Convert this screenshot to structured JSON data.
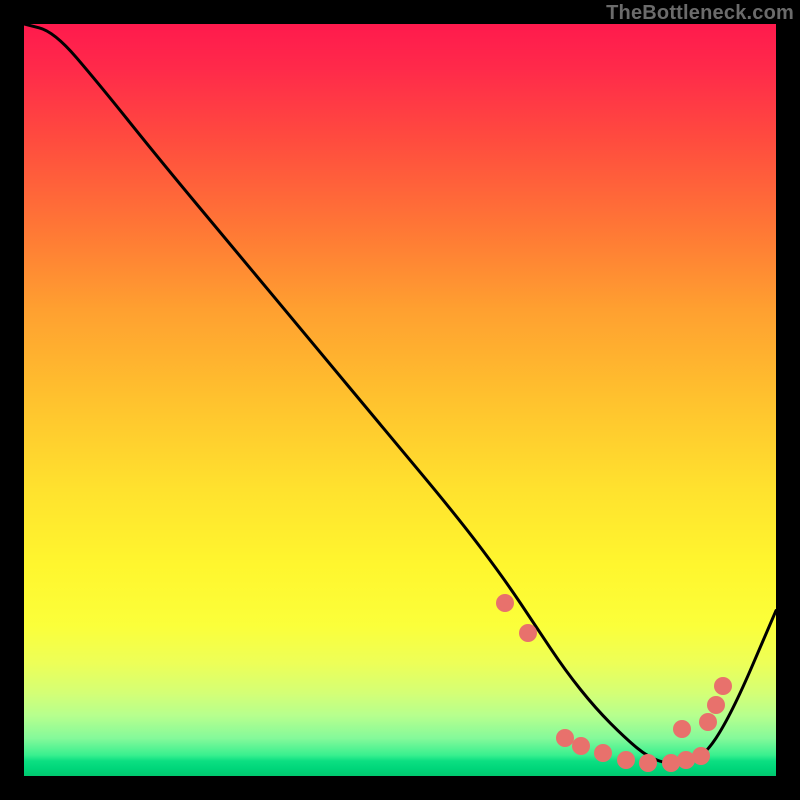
{
  "attribution": "TheBottleneck.com",
  "colors": {
    "line": "#000000",
    "dots": "#e8716c",
    "background": "#000000"
  },
  "chart_data": {
    "type": "line",
    "title": "",
    "xlabel": "",
    "ylabel": "",
    "xlim": [
      0,
      100
    ],
    "ylim": [
      0,
      100
    ],
    "grid": false,
    "note": "axes hidden; y inverted visually (curve minimum at bottom)",
    "series": [
      {
        "name": "bottleneck-curve",
        "x": [
          0,
          4,
          10,
          18,
          28,
          38,
          48,
          58,
          64,
          68,
          72,
          76,
          80,
          83,
          86,
          90,
          94,
          100
        ],
        "y": [
          100,
          99,
          92,
          82,
          70,
          58,
          46,
          34,
          26,
          20,
          14,
          9,
          5,
          2.5,
          1.5,
          2,
          8,
          22
        ]
      }
    ],
    "dots": {
      "name": "dot-cluster",
      "series_ref": "bottleneck-curve",
      "x": [
        64,
        67,
        72,
        74,
        77,
        80,
        83,
        86,
        88,
        87.5,
        90,
        91,
        92,
        93
      ],
      "y": [
        23,
        19,
        5,
        4,
        3,
        2.2,
        1.8,
        1.8,
        2.2,
        6.2,
        2.6,
        7.2,
        9.5,
        12
      ]
    }
  }
}
